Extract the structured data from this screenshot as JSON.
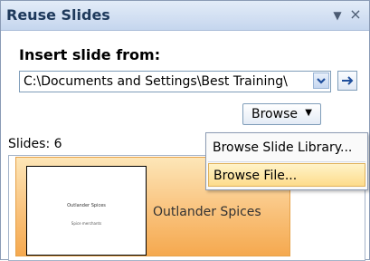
{
  "pane": {
    "title": "Reuse Slides",
    "menu_glyph": "▼",
    "close_glyph": "×"
  },
  "insert": {
    "heading": "Insert slide from:",
    "path_value": "C:\\Documents and Settings\\Best Training\\",
    "go_glyph": "→"
  },
  "browse": {
    "label": "Browse",
    "caret": "▼",
    "menu": [
      "Browse Slide Library...",
      "Browse File..."
    ]
  },
  "slides": {
    "count_label": "Slides: 6",
    "items": [
      {
        "name": "Outlander Spices",
        "thumb_title": "Outlander Spices",
        "thumb_subtitle": "Spice merchants"
      }
    ]
  },
  "colors": {
    "accent": "#1e395b",
    "highlight": "#fddc8c",
    "selected_slide": "#f9c27c"
  }
}
